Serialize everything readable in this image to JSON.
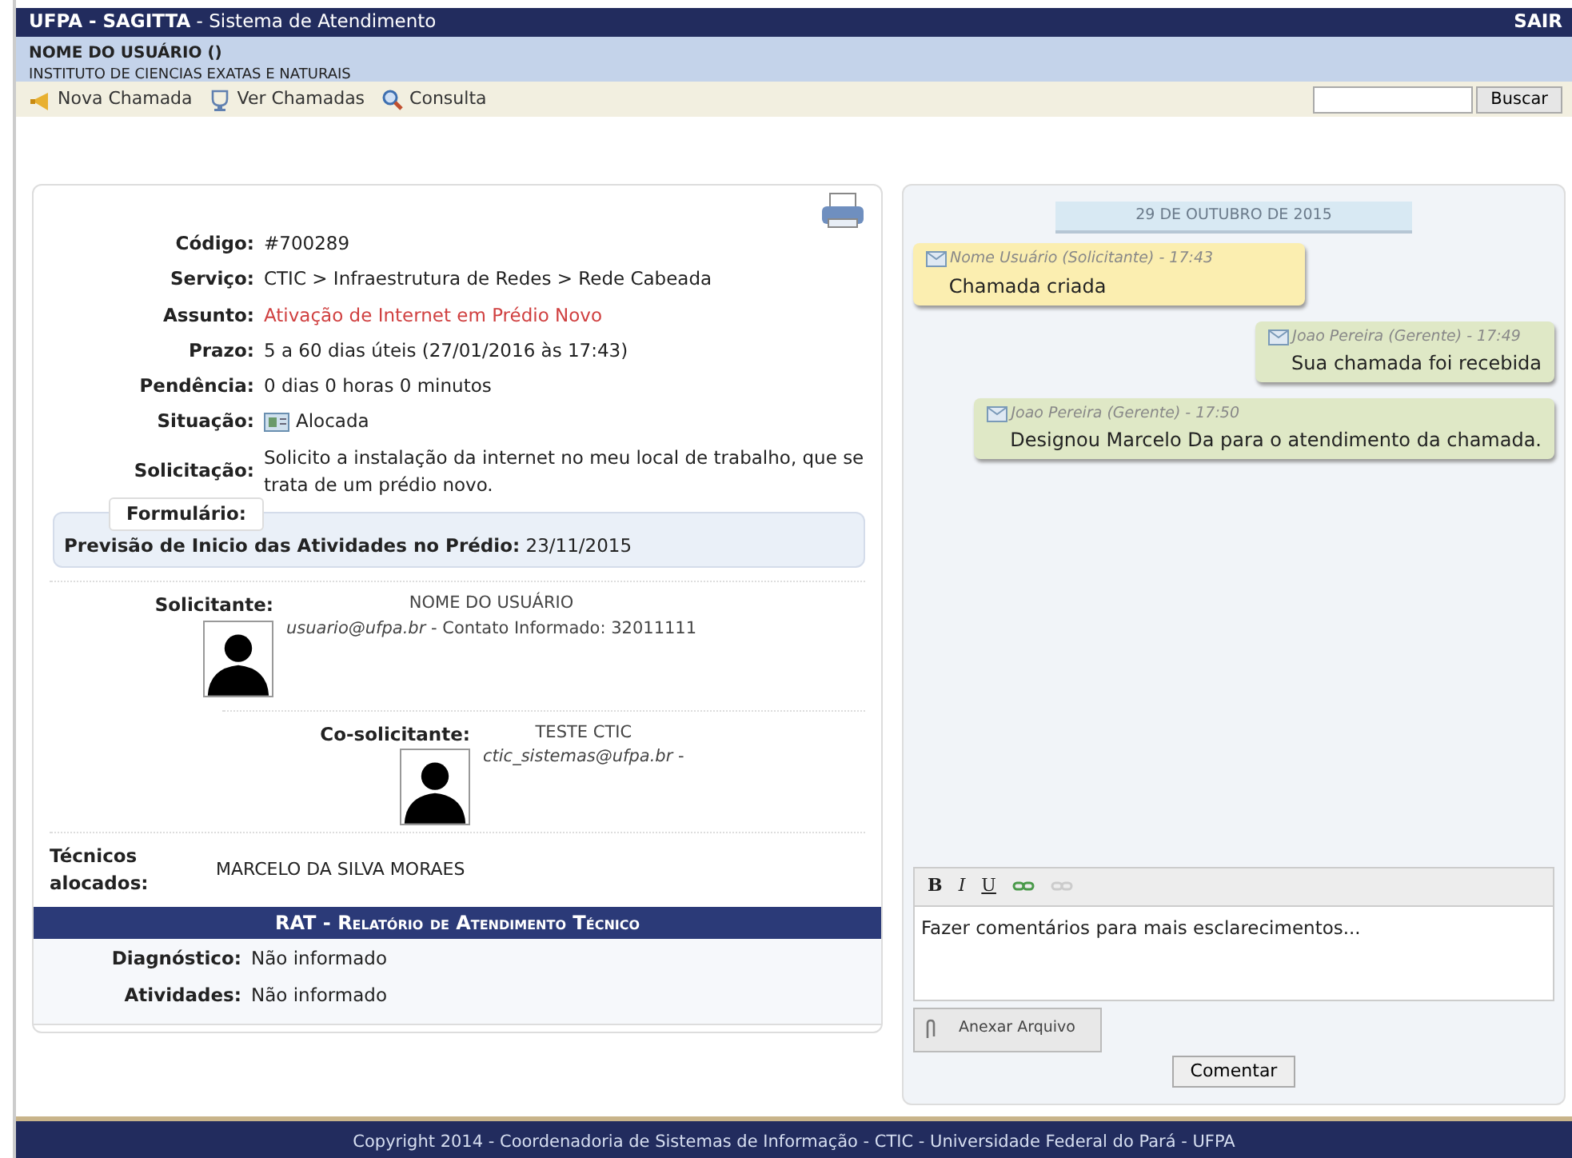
{
  "header": {
    "title": "**UFPA - SAGITTA** - Sistema de Atendimento",
    "logout": "SAIR"
  },
  "user": {
    "name": "NOME DO USUÁRIO ()",
    "unit": "INSTITUTO DE CIENCIAS EXATAS E NATURAIS"
  },
  "toolbar": {
    "items": [
      {
        "kind": "megaphone",
        "label": "Nova Chamada"
      },
      {
        "kind": "cup",
        "label": "Ver Chamadas"
      },
      {
        "kind": "search",
        "label": "Consulta"
      }
    ],
    "search_button": "Buscar"
  },
  "details": [
    {
      "label": "Código:",
      "value": "#700289",
      "kind": "plain"
    },
    {
      "label": "Serviço:",
      "value": "CTIC > Infraestrutura de Redes > Rede Cabeada",
      "kind": "plain"
    },
    {
      "label": "Assunto:",
      "value": "Ativação de Internet em Prédio Novo",
      "kind": "highlight"
    },
    {
      "label": "Prazo:",
      "value": "5 a 60 dias úteis (27/01/2016 às 17:43)",
      "kind": "plain"
    },
    {
      "label": "Pendência:",
      "value": "0 dias 0 horas 0 minutos",
      "kind": "plain"
    },
    {
      "label": "Situação:",
      "value": "Alocada",
      "kind": "status"
    },
    {
      "label": "Solicitação:",
      "value": "Solicito a instalação da internet no meu local de trabalho, que se trata de um prédio novo.",
      "kind": "plain"
    }
  ],
  "form": {
    "legend": "Formulário:",
    "label": "Previsão de Inicio das Atividades no Prédio:",
    "value": "23/11/2015"
  },
  "people": [
    {
      "role": "Solicitante:",
      "name": "NOME DO USUÁRIO",
      "email": "usuario@ufpa.br",
      "contact": " - Contato Informado: 32011111"
    },
    {
      "role": "Co-solicitante:",
      "name": "TESTE CTIC",
      "email": "ctic_sistemas@ufpa.br",
      "contact": " -"
    }
  ],
  "technicians": {
    "label": "Técnicos alocados:",
    "value": "MARCELO DA SILVA MORAES"
  },
  "rat": {
    "title": "**RAT** - Relatório de Atendimento Técnico",
    "rows": [
      {
        "label": "Diagnóstico:",
        "value": "Não informado"
      },
      {
        "label": "Atividades:",
        "value": "Não informado"
      }
    ]
  },
  "timeline": {
    "date": "29 DE OUTUBRO DE 2015",
    "messages": [
      {
        "author": "Nome Usuário (Solicitante) - 17:43",
        "text": "Chamada criada",
        "kind": "request",
        "color": "#fbeeb0"
      },
      {
        "author": "Joao Pereira (Gerente) - 17:49",
        "text": "Sua chamada foi recebida",
        "kind": "reply",
        "color": "#dfe8c6"
      },
      {
        "author": "Joao Pereira (Gerente) - 17:50",
        "text": "Designou Marcelo Da para o atendimento da chamada.",
        "kind": "reply",
        "color": "#dfe8c6"
      }
    ]
  },
  "editor": {
    "tools": [
      {
        "kind": "bold",
        "label": "B"
      },
      {
        "kind": "italic",
        "label": "I"
      },
      {
        "kind": "underline",
        "label": "U"
      },
      {
        "kind": "link",
        "disabled": false
      },
      {
        "kind": "unlink",
        "disabled": true
      }
    ],
    "value": "Fazer comentários para mais esclarecimentos...",
    "attach_button": "Anexar Arquivo",
    "submit_button": "Comentar"
  },
  "footer": "Copyright 2014 - Coordenadoria de Sistemas de Informação - CTIC - Universidade Federal do Pará - UFPA"
}
